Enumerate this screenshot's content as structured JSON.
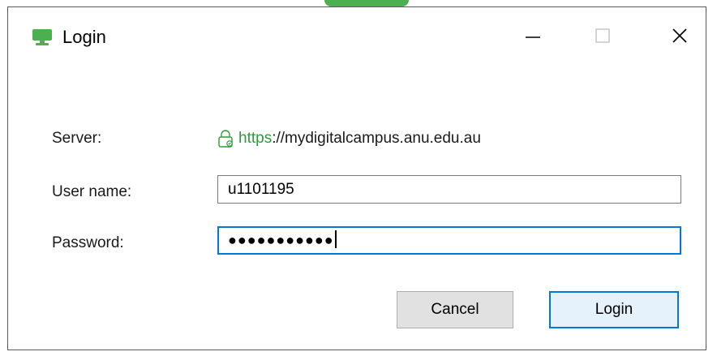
{
  "window": {
    "title": "Login",
    "icon": "monitor-app-icon",
    "controls": {
      "minimize": "minimize-icon",
      "maximize": "maximize-icon",
      "close": "close-icon"
    }
  },
  "form": {
    "server_label": "Server:",
    "server_scheme": "https",
    "server_rest": "://mydigitalcampus.anu.edu.au",
    "username_label": "User name:",
    "username_value": "u1101195",
    "password_label": "Password:",
    "password_mask": "●●●●●●●●●●●"
  },
  "buttons": {
    "cancel": "Cancel",
    "login": "Login"
  },
  "colors": {
    "accent": "#0078d7",
    "secure_green": "#2e9a3a",
    "app_icon_green": "#4caf50"
  }
}
